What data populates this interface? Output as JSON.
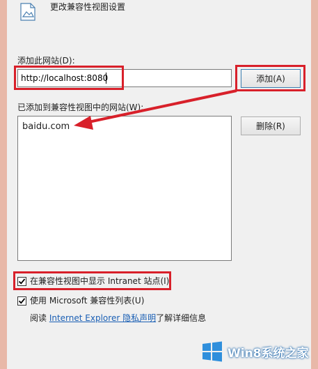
{
  "header": {
    "title": "更改兼容性视图设置"
  },
  "add_site": {
    "label": "添加此网站(D):",
    "input_value": "http://localhost:8080",
    "add_button": "添加(A)"
  },
  "added_sites": {
    "label": "已添加到兼容性视图中的网站(W):",
    "items": [
      "baidu.com"
    ],
    "remove_button": "删除(R)"
  },
  "options": {
    "intranet": {
      "label": "在兼容性视图中显示 Intranet 站点(I)",
      "checked": true
    },
    "microsoft_list": {
      "label": "使用 Microsoft 兼容性列表(U)",
      "checked": true
    }
  },
  "footer": {
    "prefix": "阅读 ",
    "link": "Internet Explorer 隐私声明",
    "suffix": "了解详细信息"
  },
  "watermark": {
    "text": "Win8系统之家"
  },
  "colors": {
    "annotation_red": "#d8202a",
    "link_blue": "#1a5fb4",
    "window_border": "#e8b8a8"
  }
}
